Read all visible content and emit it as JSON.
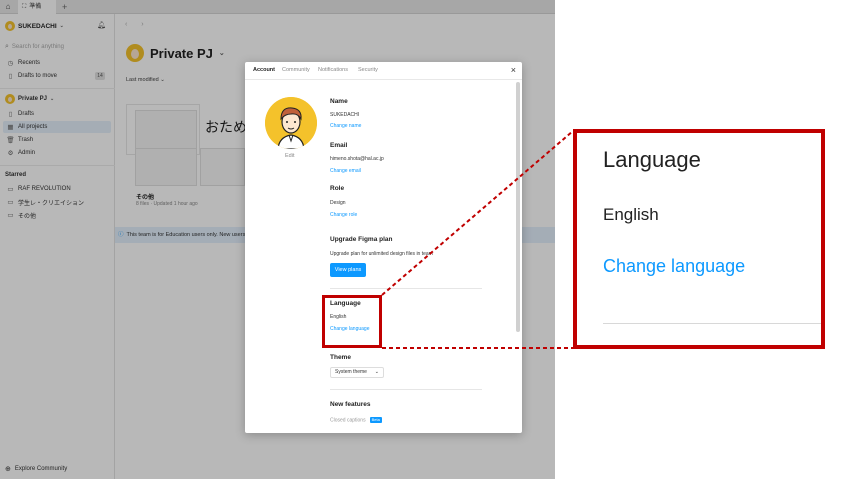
{
  "tabs": {
    "file_tab_label": "準備"
  },
  "sidebar": {
    "team_name": "SUKEDACHI",
    "search_placeholder": "Search for anything",
    "items_top": [
      {
        "label": "Recents",
        "icon": "clock-icon"
      },
      {
        "label": "Drafts to move",
        "icon": "file-icon",
        "badge": "14"
      }
    ],
    "project_section": "Private PJ",
    "items_project": [
      {
        "label": "Drafts",
        "icon": "file-icon"
      },
      {
        "label": "All projects",
        "icon": "grid-icon"
      },
      {
        "label": "Trash",
        "icon": "trash-icon"
      },
      {
        "label": "Admin",
        "icon": "gear-icon"
      }
    ],
    "starred_heading": "Starred",
    "starred_items": [
      {
        "label": "RAF REVOLUTION"
      },
      {
        "label": "学生レ・クリエイション"
      },
      {
        "label": "その他"
      }
    ],
    "bottom_label": "Explore Community"
  },
  "main": {
    "title": "Private PJ",
    "sort_label": "Last modified ⌄",
    "card_big_text": "おため",
    "card_name": "その他",
    "card_meta": "8 files · Updated 1 hour ago",
    "banner_text": "This team is for Education users only. New users wil"
  },
  "modal": {
    "tabs": [
      "Account",
      "Community",
      "Notifications",
      "Security"
    ],
    "edit_label": "Edit",
    "name_label": "Name",
    "name_value": "SUKEDACHI",
    "name_link": "Change name",
    "email_label": "Email",
    "email_value": "himeno.shota@hal.ac.jp",
    "email_link": "Change email",
    "role_label": "Role",
    "role_value": "Design",
    "role_link": "Change role",
    "plan_label": "Upgrade Figma plan",
    "plan_text": "Upgrade plan for unlimited design files in team",
    "plan_button": "View plans",
    "language_label": "Language",
    "language_value": "English",
    "language_link": "Change language",
    "theme_label": "Theme",
    "theme_value": "System theme",
    "features_label": "New features",
    "features_item": "Closed captions",
    "features_badge": "Beta"
  },
  "zoom": {
    "label": "Language",
    "value": "English",
    "link": "Change language"
  },
  "colors": {
    "accent": "#0d99ff",
    "highlight": "#c00000",
    "avatar": "#f4c22b"
  }
}
